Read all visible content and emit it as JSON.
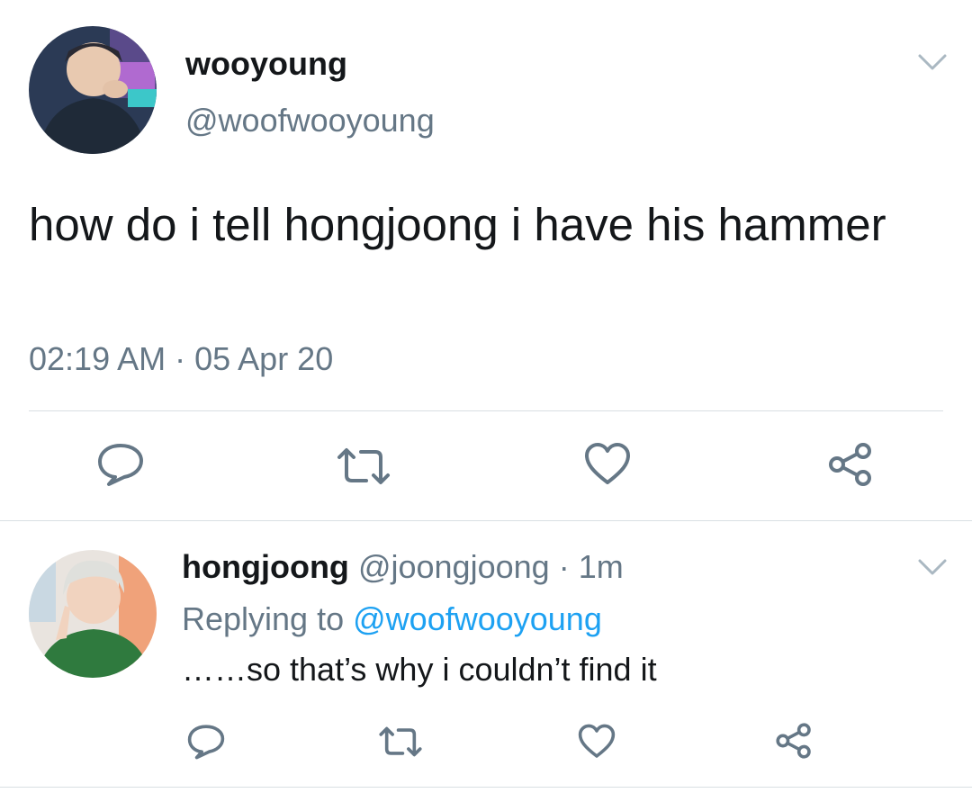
{
  "tweet": {
    "author_name": "wooyoung",
    "author_handle": "@woofwooyoung",
    "text": "how do i tell hongjoong i have his hammer",
    "timestamp": "02:19 AM · 05 Apr 20",
    "icons": {
      "reply": "reply-icon",
      "retweet": "retweet-icon",
      "like": "heart-icon",
      "share": "share-icon",
      "menu": "chevron-down-icon"
    }
  },
  "reply": {
    "author_name": "hongjoong",
    "author_handle": "@joongjoong",
    "separator": "·",
    "age": "1m",
    "replying_prefix": "Replying to",
    "replying_to": "@woofwooyoung",
    "text": "……so that’s why i couldn’t find it"
  },
  "colors": {
    "text_primary": "#14171a",
    "text_secondary": "#657786",
    "link": "#1da1f2",
    "icon": "#657786",
    "divider": "#d9dfe3"
  }
}
